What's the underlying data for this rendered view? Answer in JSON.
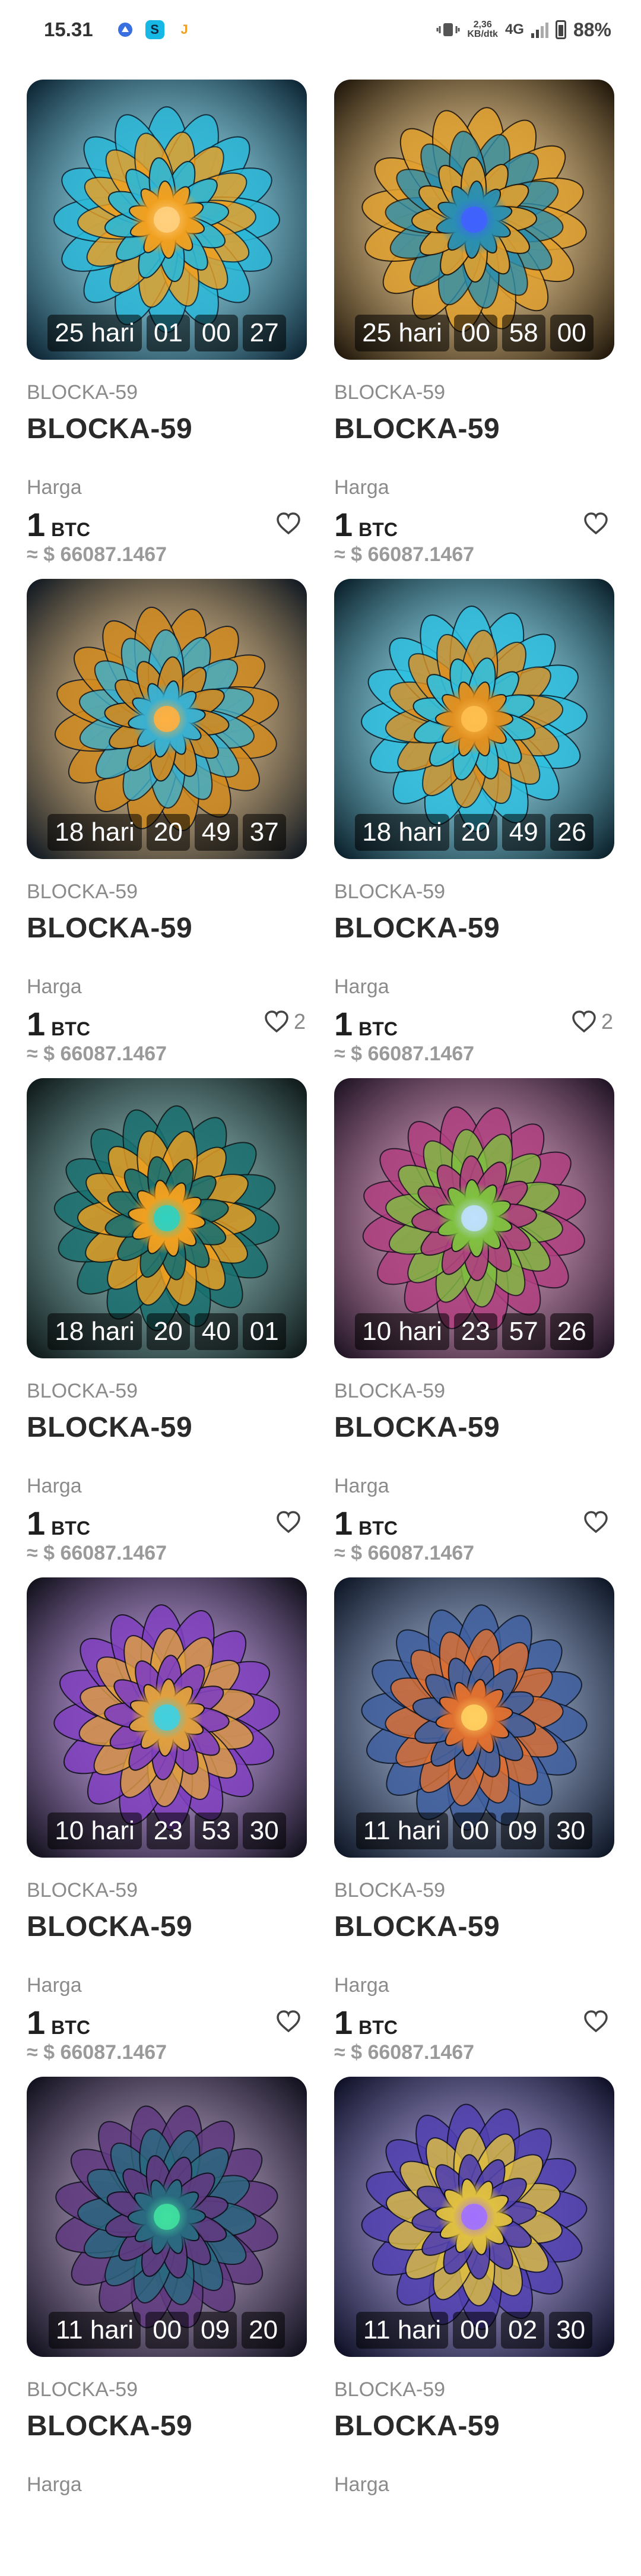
{
  "status_bar": {
    "time": "15.31",
    "net_speed_top": "2,36",
    "net_speed_bottom": "KB/dtk",
    "network": "4G",
    "battery": "88%"
  },
  "labels": {
    "price_label": "Harga",
    "currency": "BTC"
  },
  "cards": [
    {
      "collection": "BLOCKA-59",
      "name": "BLOCKA-59",
      "timer": [
        "25 hari",
        "01",
        "00",
        "27"
      ],
      "price": "1",
      "usd": "≈ $ 66087.1467",
      "likes": "",
      "palette": [
        "#0a1f2e",
        "#2bb8d8",
        "#f0a020",
        "#ffd080"
      ]
    },
    {
      "collection": "BLOCKA-59",
      "name": "BLOCKA-59",
      "timer": [
        "25 hari",
        "00",
        "58",
        "00"
      ],
      "price": "1",
      "usd": "≈ $ 66087.1467",
      "likes": "",
      "palette": [
        "#1a1208",
        "#e0a030",
        "#2a8fb0",
        "#4060ff"
      ]
    },
    {
      "collection": "BLOCKA-59",
      "name": "BLOCKA-59",
      "timer": [
        "18 hari",
        "20",
        "49",
        "37"
      ],
      "price": "1",
      "usd": "≈ $ 66087.1467",
      "likes": "2",
      "palette": [
        "#0a1420",
        "#d08a20",
        "#3ab0d0",
        "#ffb040"
      ]
    },
    {
      "collection": "BLOCKA-59",
      "name": "BLOCKA-59",
      "timer": [
        "18 hari",
        "20",
        "49",
        "26"
      ],
      "price": "1",
      "usd": "≈ $ 66087.1467",
      "likes": "2",
      "palette": [
        "#071a24",
        "#30c0e0",
        "#e09020",
        "#ffc050"
      ]
    },
    {
      "collection": "BLOCKA-59",
      "name": "BLOCKA-59",
      "timer": [
        "18 hari",
        "20",
        "40",
        "01"
      ],
      "price": "1",
      "usd": "≈ $ 66087.1467",
      "likes": "",
      "palette": [
        "#0c1414",
        "#1a7070",
        "#f0a020",
        "#30d0c0"
      ]
    },
    {
      "collection": "BLOCKA-59",
      "name": "BLOCKA-59",
      "timer": [
        "10 hari",
        "23",
        "57",
        "26"
      ],
      "price": "1",
      "usd": "≈ $ 66087.1467",
      "likes": "",
      "palette": [
        "#1a1020",
        "#b04080",
        "#80c040",
        "#c0e0ff"
      ]
    },
    {
      "collection": "BLOCKA-59",
      "name": "BLOCKA-59",
      "timer": [
        "10 hari",
        "23",
        "53",
        "30"
      ],
      "price": "1",
      "usd": "≈ $ 66087.1467",
      "likes": "",
      "palette": [
        "#0c0c14",
        "#8040c0",
        "#e0a040",
        "#40d0e0"
      ]
    },
    {
      "collection": "BLOCKA-59",
      "name": "BLOCKA-59",
      "timer": [
        "11 hari",
        "00",
        "09",
        "30"
      ],
      "price": "1",
      "usd": "≈ $ 66087.1467",
      "likes": "",
      "palette": [
        "#0a1220",
        "#4060a0",
        "#e07030",
        "#ffd060"
      ]
    },
    {
      "collection": "BLOCKA-59",
      "name": "BLOCKA-59",
      "timer": [
        "11 hari",
        "00",
        "09",
        "20"
      ],
      "price": "",
      "usd": "",
      "likes": "",
      "palette": [
        "#0c0c18",
        "#603a80",
        "#2a6a80",
        "#40e0a0"
      ]
    },
    {
      "collection": "BLOCKA-59",
      "name": "BLOCKA-59",
      "timer": [
        "11 hari",
        "00",
        "02",
        "30"
      ],
      "price": "",
      "usd": "",
      "likes": "",
      "palette": [
        "#0a0c20",
        "#5040b0",
        "#e0c040",
        "#a070ff"
      ]
    }
  ]
}
